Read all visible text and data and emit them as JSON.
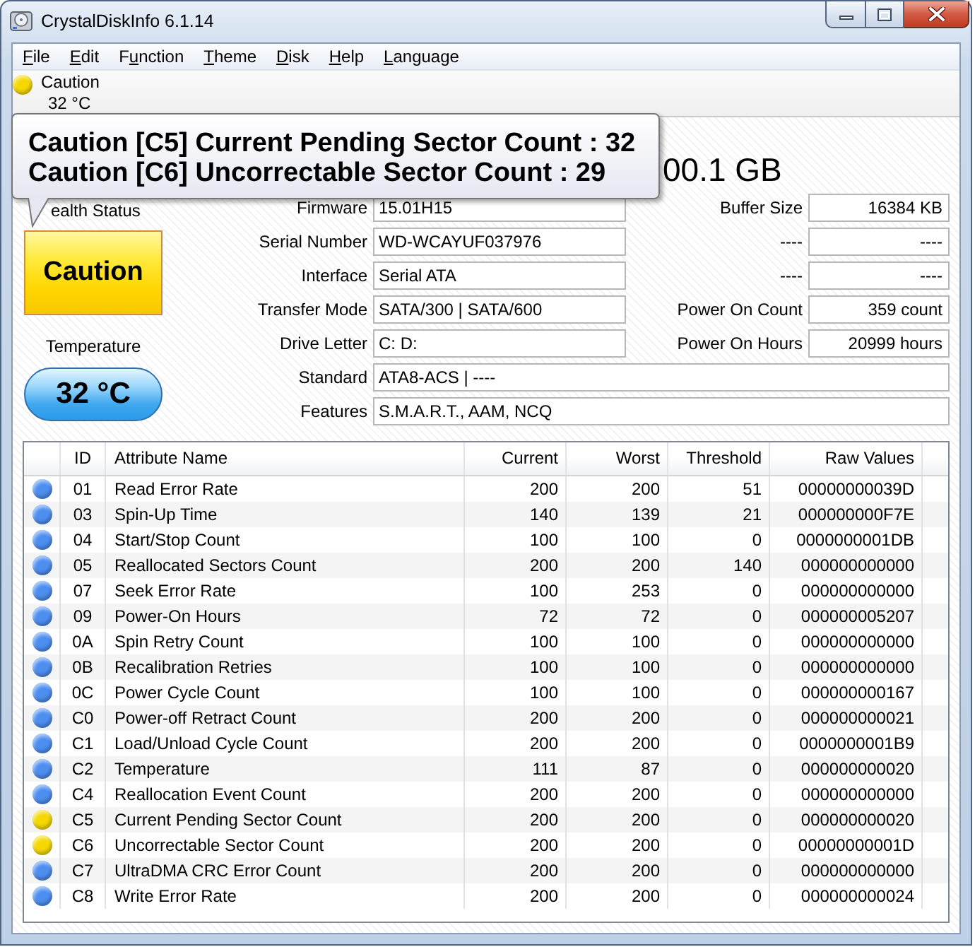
{
  "window": {
    "title": "CrystalDiskInfo 6.1.14"
  },
  "menu": [
    {
      "key": "F",
      "post": "ile"
    },
    {
      "key": "E",
      "post": "dit"
    },
    {
      "pre": "F",
      "key": "u",
      "post": "nction"
    },
    {
      "key": "T",
      "post": "heme"
    },
    {
      "key": "D",
      "post": "isk"
    },
    {
      "key": "H",
      "post": "elp"
    },
    {
      "key": "L",
      "post": "anguage"
    }
  ],
  "disk_bar": {
    "status": "Caution",
    "temperature": "32 °C",
    "color": "#f5d800"
  },
  "tooltip": {
    "lines": [
      "Caution [C5] Current Pending Sector Count : 32",
      "Caution [C6] Uncorrectable Sector Count : 29"
    ]
  },
  "drive_title": "00.1 GB",
  "health": {
    "label": "ealth Status",
    "value": "Caution",
    "kind": "caution"
  },
  "temperature": {
    "label": "Temperature",
    "value": "32 °C",
    "kind": "normal"
  },
  "info": {
    "pairs": [
      {
        "label": "Firmware",
        "value": "15.01H15",
        "label_2": "Buffer Size",
        "value_2": "16384 KB"
      },
      {
        "label": "Serial Number",
        "value": "WD-WCAYUF037976",
        "label_2": "----",
        "value_2": "----"
      },
      {
        "label": "Interface",
        "value": "Serial ATA",
        "label_2": "----",
        "value_2": "----"
      },
      {
        "label": "Transfer Mode",
        "value": "SATA/300 | SATA/600",
        "label_2": "Power On Count",
        "value_2": "359 count"
      },
      {
        "label": "Drive Letter",
        "value": "C: D:",
        "label_2": "Power On Hours",
        "value_2": "20999 hours"
      }
    ],
    "wide": [
      {
        "label": "Standard",
        "value": "ATA8-ACS | ----"
      },
      {
        "label": "Features",
        "value": "S.M.A.R.T., AAM, NCQ"
      }
    ]
  },
  "table": {
    "columns": [
      "ID",
      "Attribute Name",
      "Current",
      "Worst",
      "Threshold",
      "Raw Values"
    ],
    "rows": [
      {
        "color": "#4d8ff0",
        "id": "01",
        "name": "Read Error Rate",
        "current": "200",
        "worst": "200",
        "threshold": "51",
        "raw": "00000000039D"
      },
      {
        "color": "#4d8ff0",
        "id": "03",
        "name": "Spin-Up Time",
        "current": "140",
        "worst": "139",
        "threshold": "21",
        "raw": "000000000F7E"
      },
      {
        "color": "#4d8ff0",
        "id": "04",
        "name": "Start/Stop Count",
        "current": "100",
        "worst": "100",
        "threshold": "0",
        "raw": "0000000001DB"
      },
      {
        "color": "#4d8ff0",
        "id": "05",
        "name": "Reallocated Sectors Count",
        "current": "200",
        "worst": "200",
        "threshold": "140",
        "raw": "000000000000"
      },
      {
        "color": "#4d8ff0",
        "id": "07",
        "name": "Seek Error Rate",
        "current": "100",
        "worst": "253",
        "threshold": "0",
        "raw": "000000000000"
      },
      {
        "color": "#4d8ff0",
        "id": "09",
        "name": "Power-On Hours",
        "current": "72",
        "worst": "72",
        "threshold": "0",
        "raw": "000000005207"
      },
      {
        "color": "#4d8ff0",
        "id": "0A",
        "name": "Spin Retry Count",
        "current": "100",
        "worst": "100",
        "threshold": "0",
        "raw": "000000000000"
      },
      {
        "color": "#4d8ff0",
        "id": "0B",
        "name": "Recalibration Retries",
        "current": "100",
        "worst": "100",
        "threshold": "0",
        "raw": "000000000000"
      },
      {
        "color": "#4d8ff0",
        "id": "0C",
        "name": "Power Cycle Count",
        "current": "100",
        "worst": "100",
        "threshold": "0",
        "raw": "000000000167"
      },
      {
        "color": "#4d8ff0",
        "id": "C0",
        "name": "Power-off Retract Count",
        "current": "200",
        "worst": "200",
        "threshold": "0",
        "raw": "000000000021"
      },
      {
        "color": "#4d8ff0",
        "id": "C1",
        "name": "Load/Unload Cycle Count",
        "current": "200",
        "worst": "200",
        "threshold": "0",
        "raw": "0000000001B9"
      },
      {
        "color": "#4d8ff0",
        "id": "C2",
        "name": "Temperature",
        "current": "111",
        "worst": "87",
        "threshold": "0",
        "raw": "000000000020"
      },
      {
        "color": "#4d8ff0",
        "id": "C4",
        "name": "Reallocation Event Count",
        "current": "200",
        "worst": "200",
        "threshold": "0",
        "raw": "000000000000"
      },
      {
        "color": "#f5d800",
        "id": "C5",
        "name": "Current Pending Sector Count",
        "current": "200",
        "worst": "200",
        "threshold": "0",
        "raw": "000000000020"
      },
      {
        "color": "#f5d800",
        "id": "C6",
        "name": "Uncorrectable Sector Count",
        "current": "200",
        "worst": "200",
        "threshold": "0",
        "raw": "00000000001D"
      },
      {
        "color": "#4d8ff0",
        "id": "C7",
        "name": "UltraDMA CRC Error Count",
        "current": "200",
        "worst": "200",
        "threshold": "0",
        "raw": "000000000000"
      },
      {
        "color": "#4d8ff0",
        "id": "C8",
        "name": "Write Error Rate",
        "current": "200",
        "worst": "200",
        "threshold": "0",
        "raw": "000000000024"
      }
    ]
  }
}
